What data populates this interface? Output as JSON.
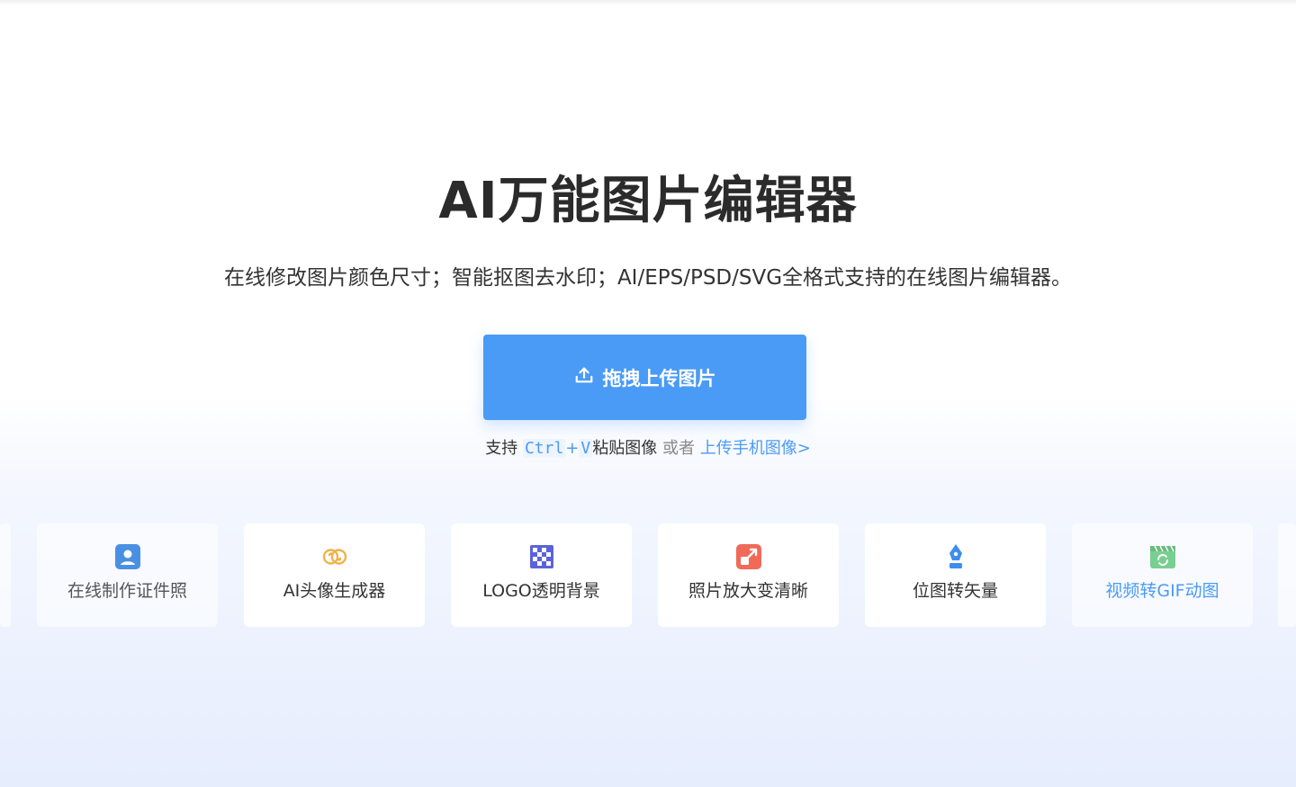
{
  "hero": {
    "title": "AI万能图片编辑器",
    "subtitle": "在线修改图片颜色尺寸；智能抠图去水印；AI/EPS/PSD/SVG全格式支持的在线图片编辑器。"
  },
  "upload": {
    "button_label": "拖拽上传图片",
    "icon": "upload-icon",
    "accent_color": "#4a9bf5"
  },
  "hint": {
    "prefix": "支持",
    "key1": "Ctrl",
    "plus": "+",
    "key2": "V",
    "paste_text": "粘贴图像",
    "or_text": "或者",
    "mobile_link": "上传手机图像>"
  },
  "tools": [
    {
      "label": "在线制作证件照",
      "icon": "id-photo-icon",
      "color": "#4a90e2"
    },
    {
      "label": "AI头像生成器",
      "icon": "ai-avatar-icon",
      "color": "#f0b24a"
    },
    {
      "label": "LOGO透明背景",
      "icon": "transparent-bg-icon",
      "color": "#5b63d9"
    },
    {
      "label": "照片放大变清晰",
      "icon": "enlarge-icon",
      "color": "#f06a5a"
    },
    {
      "label": "位图转矢量",
      "icon": "vector-pen-icon",
      "color": "#3d8ef0"
    },
    {
      "label": "视频转GIF动图",
      "icon": "gif-icon",
      "color": "#4cc26a"
    }
  ]
}
